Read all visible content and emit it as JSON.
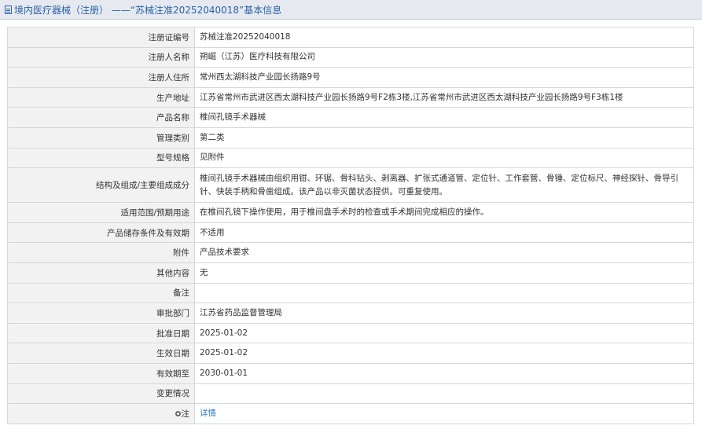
{
  "header": {
    "title": "境内医疗器械（注册） ——“苏械注准20252040018”基本信息"
  },
  "rows": [
    {
      "label": "注册证编号",
      "value": "苏械注准20252040018"
    },
    {
      "label": "注册人名称",
      "value": "朔崛（江苏）医疗科技有限公司"
    },
    {
      "label": "注册人住所",
      "value": "常州西太湖科技产业园长扬路9号"
    },
    {
      "label": "生产地址",
      "value": "江苏省常州市武进区西太湖科技产业园长扬路9号F2栋3楼,江苏省常州市武进区西太湖科技产业园长扬路9号F3栋1楼"
    },
    {
      "label": "产品名称",
      "value": "椎间孔镜手术器械"
    },
    {
      "label": "管理类别",
      "value": "第二类"
    },
    {
      "label": "型号规格",
      "value": "见附件"
    },
    {
      "label": "结构及组成/主要组成成分",
      "value": "椎间孔镜手术器械由组织用钳、环锯、骨科钻头、剥离器、扩张式通道管、定位针、工作套管、骨锤、定位标尺、神经探针、骨导引针、快装手柄和骨凿组成。该产品以非灭菌状态提供。可重复使用。"
    },
    {
      "label": "适用范围/预期用途",
      "value": "在椎间孔镜下操作使用，用于椎间盘手术时的检查或手术期间完成相应的操作。"
    },
    {
      "label": "产品储存条件及有效期",
      "value": "不适用"
    },
    {
      "label": "附件",
      "value": "产品技术要求"
    },
    {
      "label": "其他内容",
      "value": "无"
    },
    {
      "label": "备注",
      "value": ""
    },
    {
      "label": "审批部门",
      "value": "江苏省药品监督管理局"
    },
    {
      "label": "批准日期",
      "value": "2025-01-02"
    },
    {
      "label": "生效日期",
      "value": "2025-01-02"
    },
    {
      "label": "有效期至",
      "value": "2030-01-01"
    },
    {
      "label": "变更情况",
      "value": ""
    }
  ],
  "note_row": {
    "label": "注",
    "link_text": "详情"
  }
}
